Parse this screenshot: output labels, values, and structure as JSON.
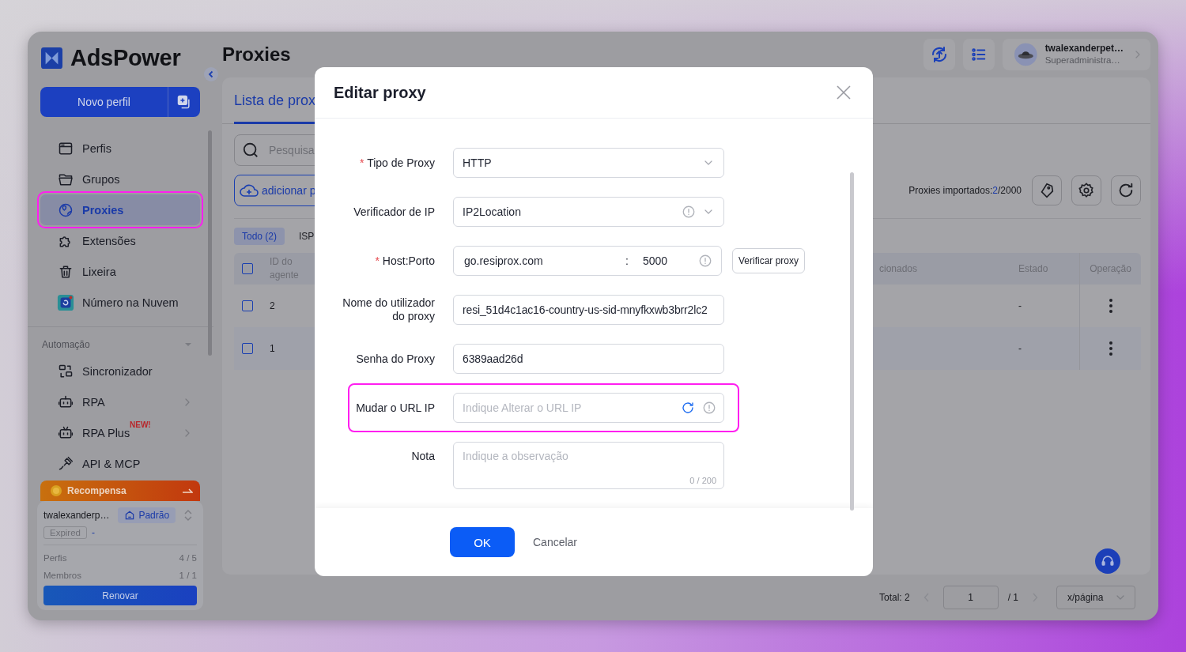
{
  "sidebar": {
    "logo": "AdsPower",
    "new_profile": "Novo perfil",
    "nav": [
      {
        "label": "Perfis",
        "selected": false,
        "highlighted": false
      },
      {
        "label": "Grupos",
        "selected": false,
        "highlighted": false
      },
      {
        "label": "Proxies",
        "selected": true,
        "highlighted": true
      },
      {
        "label": "Extensões",
        "selected": false,
        "highlighted": false
      },
      {
        "label": "Lixeira",
        "selected": false,
        "highlighted": false
      },
      {
        "label": "Número na Nuvem",
        "selected": false,
        "highlighted": false
      }
    ],
    "section": {
      "title": "Automação",
      "expanded": true
    },
    "automation": [
      {
        "label": "Sincronizador",
        "has_submenu": false
      },
      {
        "label": "RPA",
        "has_submenu": true
      },
      {
        "label": "RPA Plus",
        "badge": "NEW!",
        "has_submenu": true
      },
      {
        "label": "API & MCP",
        "has_submenu": false
      }
    ],
    "reward": {
      "label": "Recompensa"
    },
    "account": {
      "name": "twalexanderp…",
      "plan": "Padrão",
      "status": "Expired",
      "expiry": "-",
      "stats": [
        {
          "label": "Perfis",
          "value": "4 / 5"
        },
        {
          "label": "Membros",
          "value": "1 / 1"
        }
      ],
      "renew": "Renovar"
    }
  },
  "header": {
    "title": "Proxies",
    "user": {
      "name": "twalexanderpet…",
      "role": "Superadministra…"
    }
  },
  "panel": {
    "tab": "Lista de prox",
    "search": {
      "placeholder": "Pesquisa"
    },
    "add_button": "adicionar p",
    "imported": {
      "label": "Proxies importados:",
      "count": "2",
      "limit": "/2000"
    },
    "filters": [
      {
        "label": "Todo (2)",
        "selected": true
      },
      {
        "label": "ISP",
        "selected": false
      }
    ],
    "table": {
      "all_checked": false,
      "columns": [
        "ID do agente",
        "cionados",
        "Estado",
        "Operação"
      ],
      "rows": [
        {
          "checked": false,
          "id": "2",
          "state": "-"
        },
        {
          "checked": false,
          "id": "1",
          "state": "-"
        }
      ]
    }
  },
  "pagination": {
    "total": "Total: 2",
    "page": "1",
    "pages": "/ 1",
    "page_size": "x/página"
  },
  "dialog": {
    "title": "Editar proxy",
    "fields": [
      {
        "kind": "select",
        "label": "Tipo de Proxy",
        "mark": "*",
        "value": "HTTP",
        "info": false,
        "refresh": false,
        "highlighted": false
      },
      {
        "kind": "select",
        "label": "Verificador de IP",
        "value": "IP2Location",
        "info": true,
        "refresh": false,
        "highlighted": false
      },
      {
        "kind": "hostport",
        "label": "Host:Porto",
        "mark": "*",
        "value": "go.resiprox.com",
        "separator": ":",
        "port": "5000",
        "info": true,
        "refresh": false,
        "highlighted": false,
        "action": "Verificar proxy"
      },
      {
        "kind": "input",
        "label": "Nome do utilizador do proxy",
        "value": "resi_51d4c1ac16-country-us-sid-mnyfkxwb3brr2lc2",
        "info": false,
        "refresh": false,
        "highlighted": false
      },
      {
        "kind": "input",
        "label": "Senha do Proxy",
        "value": "6389aad26d",
        "info": false,
        "refresh": false,
        "highlighted": false
      },
      {
        "kind": "input",
        "label": "Mudar o URL IP",
        "placeholder": "Indique Alterar o URL IP",
        "info": true,
        "refresh": true,
        "highlighted": true
      },
      {
        "kind": "textarea",
        "label": "Nota",
        "placeholder": "Indique a observação",
        "counter": "0 / 200",
        "info": false,
        "refresh": false,
        "highlighted": false
      }
    ],
    "ok": "OK",
    "cancel": "Cancelar"
  }
}
